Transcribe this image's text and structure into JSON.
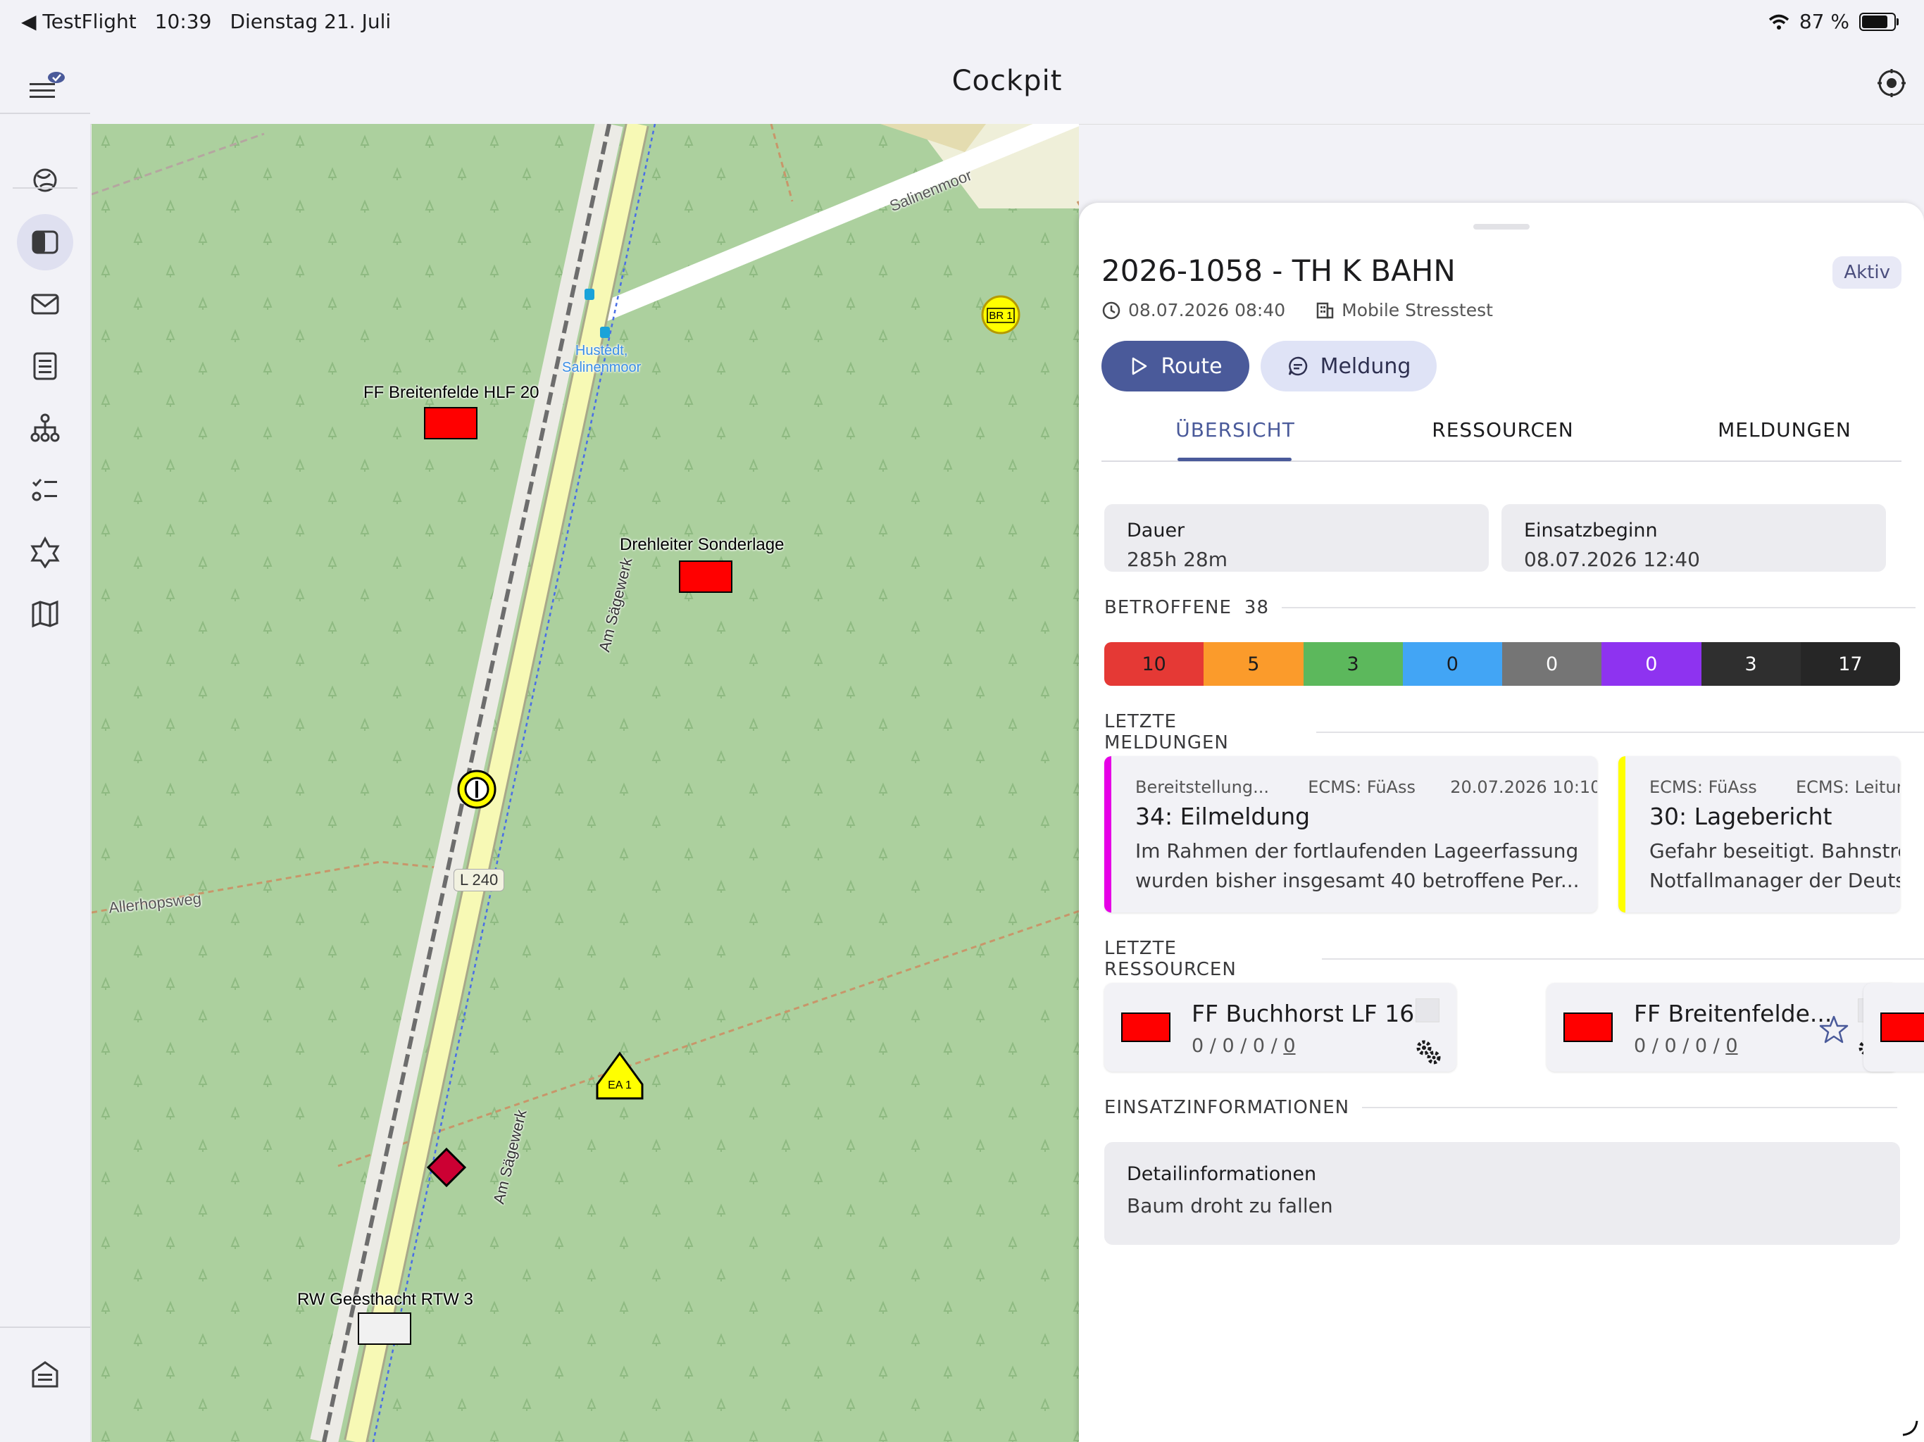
{
  "statusbar": {
    "back_app": "◀ TestFlight",
    "time": "10:39",
    "date": "Dienstag 21. Juli",
    "battery": "87 %"
  },
  "header": {
    "title": "Cockpit"
  },
  "sidebar": {
    "items": [
      {
        "name": "dashboard",
        "active": false
      },
      {
        "name": "panel",
        "active": true
      },
      {
        "name": "mail",
        "active": false
      },
      {
        "name": "list",
        "active": false
      },
      {
        "name": "hierarchy",
        "active": false
      },
      {
        "name": "checklist",
        "active": false
      },
      {
        "name": "medical",
        "active": false
      },
      {
        "name": "map",
        "active": false
      }
    ]
  },
  "map": {
    "roads": {
      "salinenmoor": "Salinenmoor",
      "am_saegewerk_1": "Am Sägewerk",
      "am_saegewerk_2": "Am Sägewerk",
      "allerhopsweg": "Allerhopsweg",
      "l240": "L 240"
    },
    "stop_label_1": "Hustedt,",
    "stop_label_2": "Salinenmoor",
    "markers": {
      "hlf20": "FF Breitenfelde HLF 20",
      "drehleiter": "Drehleiter Sonderlage",
      "rtw3": "RW Geesthacht RTW 3",
      "br1": "BR 1",
      "ea1": "EA 1"
    }
  },
  "panel": {
    "title": "2026-1058 - TH K BAHN",
    "status": "Aktiv",
    "datetime": "08.07.2026 08:40",
    "org": "Mobile Stresstest",
    "route_label": "Route",
    "meldung_label": "Meldung",
    "tabs": [
      "ÜBERSICHT",
      "RESSOURCEN",
      "MELDUNGEN"
    ],
    "dauer": {
      "label": "Dauer",
      "value": "285h 28m"
    },
    "beginn": {
      "label": "Einsatzbeginn",
      "value": "08.07.2026 12:40"
    },
    "betroffene": {
      "label": "BETROFFENE",
      "total": "38",
      "segments": [
        {
          "value": "10",
          "color": "#e53935"
        },
        {
          "value": "5",
          "color": "#fb9b2b"
        },
        {
          "value": "3",
          "color": "#5cb85c"
        },
        {
          "value": "0",
          "color": "#42a5f5"
        },
        {
          "value": "0",
          "color": "#757575"
        },
        {
          "value": "0",
          "color": "#8e33f0"
        },
        {
          "value": "3",
          "color": "#2f2f2f"
        },
        {
          "value": "17",
          "color": "#262626"
        }
      ]
    },
    "letzte_meldungen": {
      "label": "LETZTE MELDUNGEN",
      "items": [
        {
          "accent": "#e600e6",
          "from": "Bereitstellung...",
          "to": "ECMS: FüAss",
          "time": "20.07.2026 10:10",
          "title": "34:  Eilmeldung",
          "line1": "Im Rahmen der fortlaufenden Lageerfassung",
          "line2": "wurden bisher insgesamt 40 betroffene Per..."
        },
        {
          "accent": "#ffff00",
          "from": "ECMS: FüAss",
          "to": "ECMS: Leitun",
          "time": "",
          "title": "30:  Lagebericht",
          "line1": "Gefahr beseitigt. Bahnstre",
          "line2": "Notfallmanager der Deuts"
        }
      ]
    },
    "letzte_ressourcen": {
      "label": "LETZTE RESSOURCEN",
      "items": [
        {
          "name": "FF Buchhorst LF 16",
          "counts": "0 / 0 / 0 / ",
          "last": "0"
        },
        {
          "name": "FF Breitenfelde...",
          "counts": "0 / 0 / 0 / ",
          "last": "0"
        }
      ]
    },
    "einsatzinfo": {
      "label": "EINSATZINFORMATIONEN",
      "detail_label": "Detailinformationen",
      "detail_value": "Baum droht zu fallen"
    }
  }
}
